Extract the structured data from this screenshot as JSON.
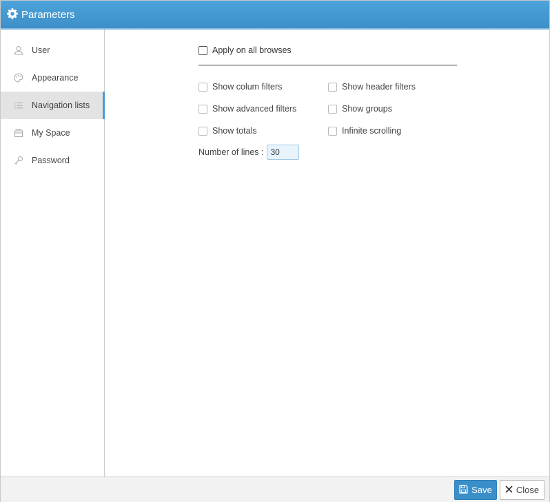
{
  "window": {
    "title": "Parameters",
    "icon": "gear-icon"
  },
  "sidebar": {
    "items": [
      {
        "label": "User",
        "icon": "user-icon",
        "active": false
      },
      {
        "label": "Appearance",
        "icon": "palette-icon",
        "active": false
      },
      {
        "label": "Navigation lists",
        "icon": "list-icon",
        "active": true
      },
      {
        "label": "My Space",
        "icon": "folder-icon",
        "active": false
      },
      {
        "label": "Password",
        "icon": "key-icon",
        "active": false
      }
    ]
  },
  "main": {
    "apply_all": {
      "label": "Apply on all browses",
      "checked": false
    },
    "options": {
      "show_column_filters": {
        "label": "Show colum filters",
        "checked": false
      },
      "show_header_filters": {
        "label": "Show header filters",
        "checked": false
      },
      "show_advanced_filters": {
        "label": "Show advanced filters",
        "checked": false
      },
      "show_groups": {
        "label": "Show groups",
        "checked": false
      },
      "show_totals": {
        "label": "Show totals",
        "checked": false
      },
      "infinite_scrolling": {
        "label": "Infinite scrolling",
        "checked": false
      }
    },
    "number_of_lines": {
      "label": "Number of lines :",
      "value": "30"
    }
  },
  "footer": {
    "save_label": "Save",
    "close_label": "Close"
  },
  "colors": {
    "accent": "#3b8fc9",
    "titlebar": "#4da3da",
    "active_item_bg": "#e3e3e3"
  }
}
